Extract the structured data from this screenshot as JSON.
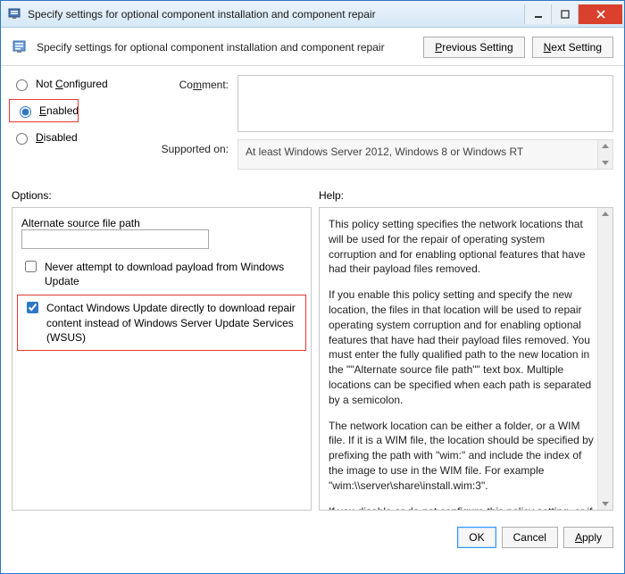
{
  "window": {
    "title": "Specify settings for optional component installation and component repair"
  },
  "header": {
    "description": "Specify settings for optional component installation and component repair",
    "prev_label": "Previous Setting",
    "next_label": "Next Setting"
  },
  "state": {
    "not_configured": "Not Configured",
    "enabled": "Enabled",
    "disabled": "Disabled",
    "selected": "Enabled"
  },
  "comment": {
    "label": "Comment:",
    "value": ""
  },
  "supported": {
    "label": "Supported on:",
    "value": "At least Windows Server 2012, Windows 8 or Windows RT"
  },
  "sections": {
    "options": "Options:",
    "help": "Help:"
  },
  "options": {
    "alt_path_label": "Alternate source file path",
    "alt_path_value": "",
    "never_download_label": "Never attempt to download payload from Windows Update",
    "never_download_checked": false,
    "contact_wu_label": "Contact Windows Update directly to download repair content instead of Windows Server Update Services (WSUS)",
    "contact_wu_checked": true
  },
  "help": {
    "p1": "This policy setting specifies the network locations that will be used for the repair of operating system corruption and for enabling optional features that have had their payload files removed.",
    "p2": "If you enable this policy setting and specify the new location, the files in that location will be used to repair operating system corruption and for enabling optional features that have had their payload files removed. You must enter the fully qualified path to the new location in the \"\"Alternate source file path\"\" text box. Multiple locations can be specified when each path is separated by a semicolon.",
    "p3": "The network location can be either a folder, or a WIM file. If it is a WIM file, the location should be specified by prefixing the path with \"wim:\" and include the index of the image to use in the WIM file. For example \"wim:\\\\server\\share\\install.wim:3\".",
    "p4": "If you disable or do not configure this policy setting, or if the required files cannot be found at the locations specified in this"
  },
  "footer": {
    "ok": "OK",
    "cancel": "Cancel",
    "apply": "Apply"
  }
}
